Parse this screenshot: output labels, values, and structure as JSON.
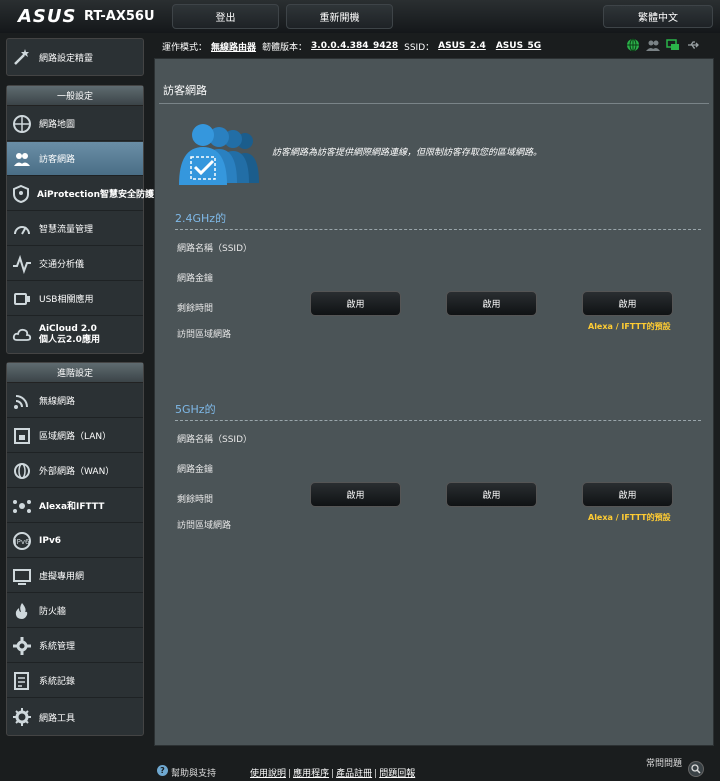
{
  "header": {
    "logo": "ASUS",
    "model": "RT-AX56U",
    "logout_label": "登出",
    "reboot_label": "重新開機",
    "language": "繁體中文"
  },
  "infobar": {
    "mode_label": "運作模式：",
    "mode_value": "無線路由器",
    "firmware_label": "韌體版本：",
    "firmware_value": "3.0.0.4.384_9428",
    "ssid_label": "SSID：",
    "ssid_24": "ASUS_2.4",
    "ssid_5": "ASUS_5G"
  },
  "sidebar": {
    "quick_setup": "網路設定精靈",
    "general_header": "一般設定",
    "general_items": [
      {
        "label": "網路地圖",
        "icon": "network-map-icon"
      },
      {
        "label": "訪客網路",
        "icon": "guest-network-icon"
      },
      {
        "label": "AiProtection智慧安全防護",
        "icon": "aiprotection-icon"
      },
      {
        "label": "智慧流量管理",
        "icon": "traffic-manager-icon"
      },
      {
        "label": "交通分析儀",
        "icon": "traffic-analyzer-icon"
      },
      {
        "label": "USB相關應用",
        "icon": "usb-icon"
      },
      {
        "label": "AiCloud 2.0",
        "label2": "個人云2.0應用",
        "icon": "aicloud-icon"
      }
    ],
    "advanced_header": "進階設定",
    "advanced_items": [
      {
        "label": "無線網路",
        "icon": "wireless-icon"
      },
      {
        "label": "區域網路（LAN）",
        "icon": "lan-icon"
      },
      {
        "label": "外部網路（WAN）",
        "icon": "wan-icon"
      },
      {
        "label": "Alexa和IFTTT",
        "icon": "alexa-icon"
      },
      {
        "label": "IPv6",
        "icon": "ipv6-icon"
      },
      {
        "label": "虛擬專用網",
        "icon": "vpn-icon"
      },
      {
        "label": "防火牆",
        "icon": "firewall-icon"
      },
      {
        "label": "系統管理",
        "icon": "administration-icon"
      },
      {
        "label": "系統記錄",
        "icon": "system-log-icon"
      },
      {
        "label": "網路工具",
        "icon": "network-tools-icon"
      }
    ]
  },
  "main": {
    "title": "訪客網路",
    "description": "訪客網路為訪客提供網際網路連線，但限制訪客存取您的區域網路。",
    "band24": {
      "header": "2.4GHz的",
      "labels": [
        "網路名稱（SSID）",
        "網路金鑰",
        "剩餘時間",
        "訪問區域網路"
      ],
      "buttons": [
        "啟用",
        "啟用",
        "啟用"
      ],
      "note": "Alexa / IFTTT的預設"
    },
    "band5": {
      "header": "5GHz的",
      "labels": [
        "網路名稱（SSID）",
        "網路金鑰",
        "剩餘時間",
        "訪問區域網路"
      ],
      "buttons": [
        "啟用",
        "啟用",
        "啟用"
      ],
      "note": "Alexa / IFTTT的預設"
    }
  },
  "footer": {
    "help": "幫助與支持",
    "links": [
      "使用說明",
      "應用程序",
      "產品註冊",
      "問題回報"
    ],
    "faq": "常問問題"
  },
  "colors": {
    "accent_blue": "#7fb9e8",
    "note_yellow": "#ffcc33",
    "active_nav": "#5a7e96"
  }
}
